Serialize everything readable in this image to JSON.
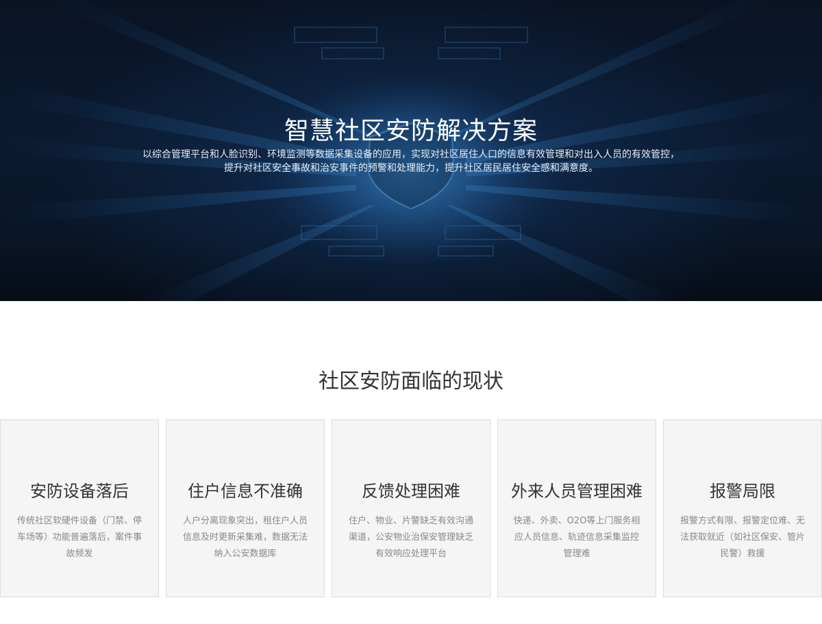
{
  "hero": {
    "title": "智慧社区安防解决方案",
    "desc_line1": "以综合管理平台和人脸识别、环境监测等数据采集设备的应用，实现对社区居住人口的信息有效管理和对出入人员的有效管控，",
    "desc_line2": "提升对社区安全事故和治安事件的预警和处理能力，提升社区居民居住安全感和满意度。"
  },
  "section": {
    "title": "社区安防面临的现状"
  },
  "cards": [
    {
      "title": "安防设备落后",
      "desc": "传统社区软硬件设备（门禁、停车场等）功能普遍落后，案件事故频发"
    },
    {
      "title": "住户信息不准确",
      "desc": "人户分离现象突出，租住户人员信息及时更新采集难，数据无法纳入公安数据库"
    },
    {
      "title": "反馈处理困难",
      "desc": "住户、物业、片警缺乏有效沟通渠道，公安物业治保安管理缺乏有效响应处理平台"
    },
    {
      "title": "外来人员管理困难",
      "desc": "快递、外卖、O2O等上门服务相应人员信息、轨迹信息采集监控管理难"
    },
    {
      "title": "报警局限",
      "desc": "报警方式有限、报警定位难、无法获取就近（如社区保安、管片民警）救援"
    }
  ],
  "colors": {
    "hero_bg": "#0a1628",
    "hero_accent": "#2a6fb0",
    "card_bg": "#f5f5f5",
    "title_text": "#333333",
    "desc_text": "#888888"
  },
  "icons": {
    "hero_decoration": "shield-circuit-graphic"
  }
}
